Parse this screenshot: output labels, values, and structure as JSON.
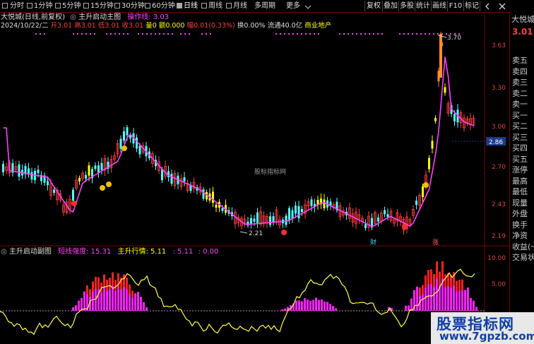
{
  "toolbar": {
    "periods": [
      "分时",
      "1分钟",
      "5分钟",
      "15分钟",
      "30分钟",
      "60分钟",
      "日线",
      "周线",
      "月线",
      "多周期",
      "更多"
    ],
    "active_period": "日线",
    "buttons": [
      "复权",
      "叠加",
      "多股",
      "统计",
      "画线",
      "F10",
      "标记"
    ],
    "more_icon": "chevron-down-icon",
    "nav_icon": "chevron-left-icon",
    "close_icon": "close-icon"
  },
  "info_row1": {
    "stock": "大悦城(日线,前复权)",
    "indicator": "主升启动主图",
    "op_label": "操作线: 3.03"
  },
  "info_row2": {
    "date": "2024/10/22/二",
    "open": "开3.01",
    "high": "高3.01",
    "low": "低3.01",
    "close": "收3.01",
    "volume": "量0",
    "amount": "额0.000",
    "change": "幅0.01(0.33%)",
    "turnover": "换0.00%",
    "float": "流通40.0亿",
    "sector": "商业地产"
  },
  "watermark": "股标指标网",
  "annotations": {
    "high_label": "3.70",
    "low_label": "2.21",
    "cur_price_tag": "2.86",
    "fin_label": "财",
    "up_label": "涨"
  },
  "price_axis": [
    "3.63",
    "3.30",
    "3.00",
    "2.70",
    "2.43",
    "2.19"
  ],
  "lower_header": {
    "title": "主升启动副图",
    "short_strength": "短线强度: 15.31",
    "main_trend": "主升行情: 5.11",
    "v1": ": 5.11",
    "v2": ": 0.00"
  },
  "lower_axis": [
    "10.00",
    "5.00"
  ],
  "side_panel": {
    "name": "大悦城",
    "price": "3.01",
    "labels": [
      "卖五",
      "卖四",
      "卖三",
      "卖二",
      "卖一",
      "买一",
      "买二",
      "买三",
      "买四",
      "买五",
      "涨停",
      "最高",
      "最低",
      "现量",
      "外盘",
      "换手",
      "净资",
      "收益(一)",
      "交易状"
    ]
  },
  "logo": {
    "line1": "股票指标网",
    "line2": "www.7gpzb.com"
  },
  "colors": {
    "up": "#ff3c3c",
    "down": "#54ffff",
    "yellow": "#ffff00",
    "magenta": "#ff40ff",
    "label": "#e04040"
  }
}
